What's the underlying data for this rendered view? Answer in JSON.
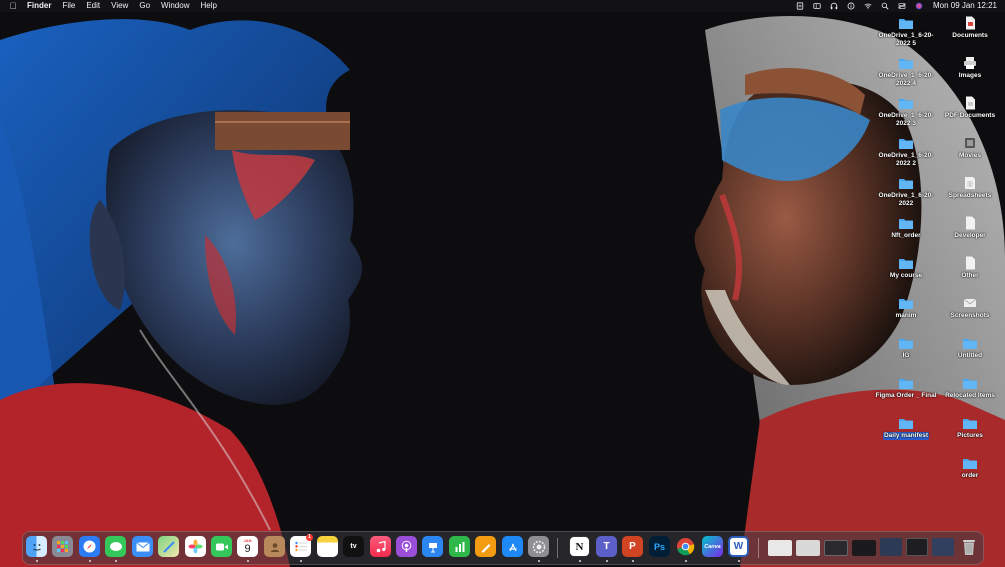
{
  "menubar": {
    "apple_icon": "apple-icon",
    "items": [
      "Finder",
      "File",
      "Edit",
      "View",
      "Go",
      "Window",
      "Help"
    ],
    "status_icons": [
      "script-icon",
      "sidebar-icon",
      "headphones-icon",
      "info-icon",
      "wifi-icon",
      "search-icon",
      "control-center-icon",
      "siri-icon"
    ],
    "clock": "Mon 09 Jan  12:21"
  },
  "desktop": {
    "left_column": [
      "OneDrive_1_6-20-2022 5",
      "OneDrive_1_6-20-2022 4",
      "OneDrive_1_6-20-2022 3",
      "OneDrive_1_6-20-2022 2",
      "OneDrive_1_6-20-2022",
      "Nft_order",
      "My course",
      "manim",
      "IG",
      "Figma Order _ Final",
      "Daily manifest"
    ],
    "right_column": [
      "Documents",
      "Images",
      "PDF Documents",
      "Movies",
      "Spreadsheets",
      "Developer",
      "Other",
      "Screenshots",
      "Untitled",
      "Relocated Items",
      "Pictures",
      "order"
    ],
    "selected": "Daily manifest",
    "folder_color": "#4aa6f0"
  },
  "dock": {
    "apps": [
      "finder-icon",
      "launchpad-icon",
      "safari-icon",
      "messages-icon",
      "mail-icon",
      "maps-icon",
      "photos-icon",
      "facetime-icon",
      "calendar-icon",
      "contacts-icon",
      "reminders-icon",
      "notes-icon",
      "appletv-icon",
      "music-icon",
      "podcasts-icon",
      "keynote-icon",
      "numbers-icon",
      "pages-icon",
      "appstore-icon",
      "settings-icon",
      "notion-icon",
      "teams-icon",
      "powerpoint-icon",
      "photoshop-icon",
      "chrome-icon",
      "canva-icon",
      "word-icon"
    ],
    "calendar_month": "JAN",
    "calendar_day": "9",
    "appletv_label": "tv",
    "reminders_badge": "1",
    "notion_label": "N",
    "teams_label": "T",
    "powerpoint_label": "P",
    "photoshop_label": "Ps",
    "canva_label": "Canva",
    "word_label": "W",
    "trash": "trash-icon"
  }
}
